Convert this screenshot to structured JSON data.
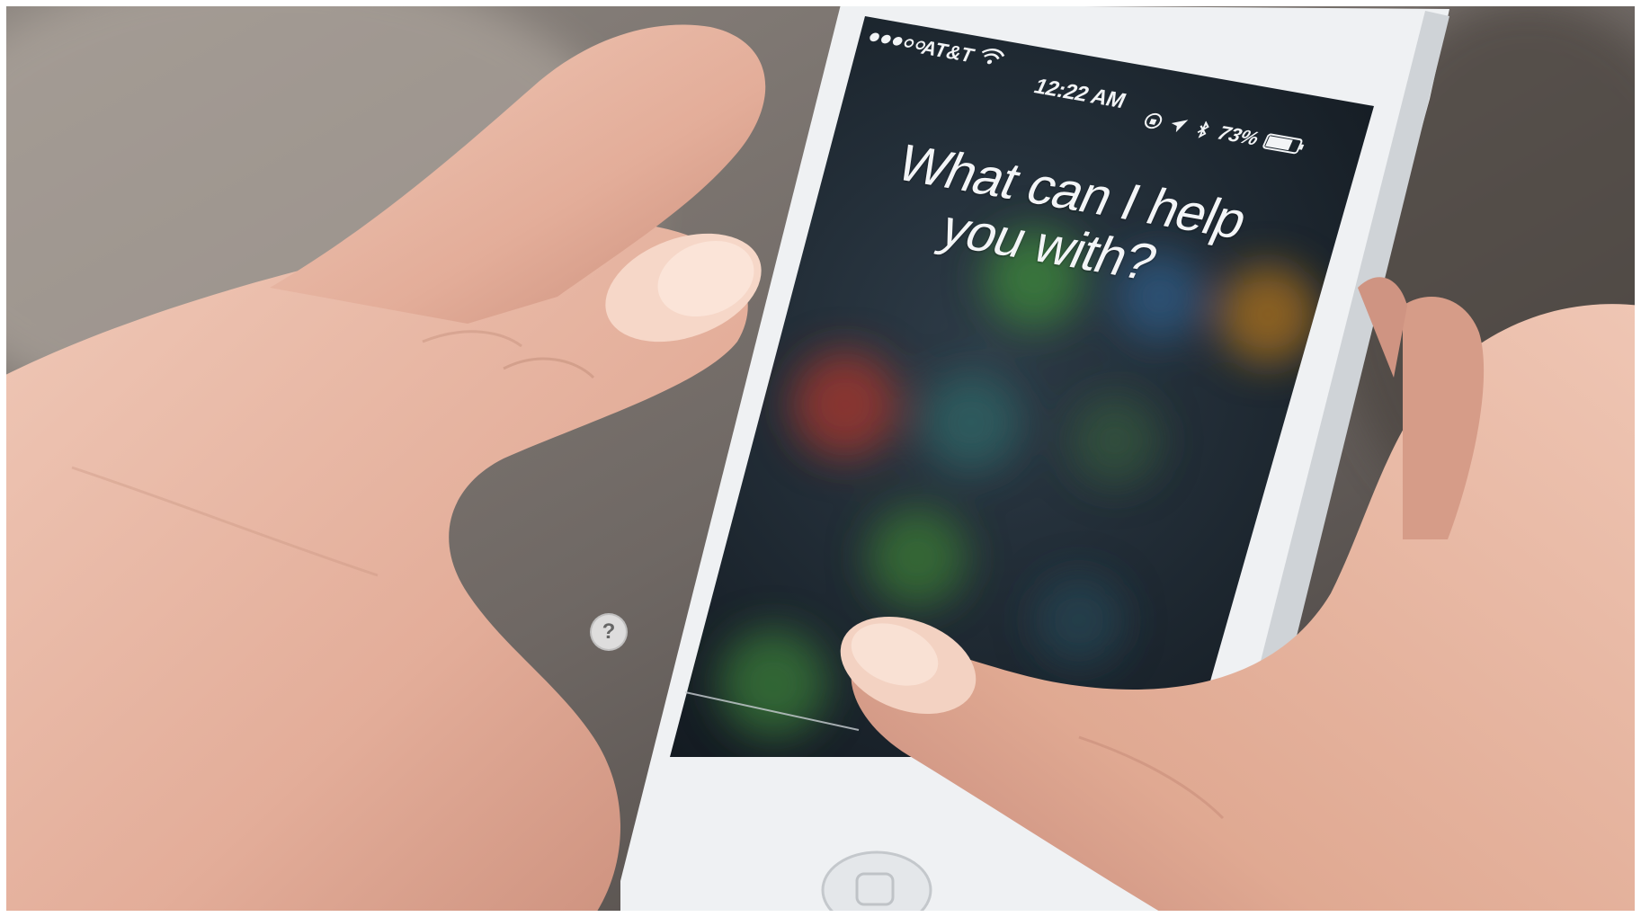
{
  "status_bar": {
    "signal": "●●●○○",
    "carrier": "AT&T",
    "time": "12:22 AM",
    "battery_percent": "73%"
  },
  "siri": {
    "prompt": "What can I help you with?"
  },
  "help": {
    "label": "?"
  },
  "colors": {
    "screen_text": "#f2f4f6",
    "phone_body": "#eef0f2",
    "skin": "#e8b9a6"
  },
  "icons": {
    "wifi": "wifi-icon",
    "battery": "battery-icon",
    "location": "location-arrow-icon",
    "bluetooth": "bluetooth-icon",
    "rotation_lock": "rotation-lock-icon",
    "help": "question-mark-icon",
    "home": "home-button-icon"
  }
}
